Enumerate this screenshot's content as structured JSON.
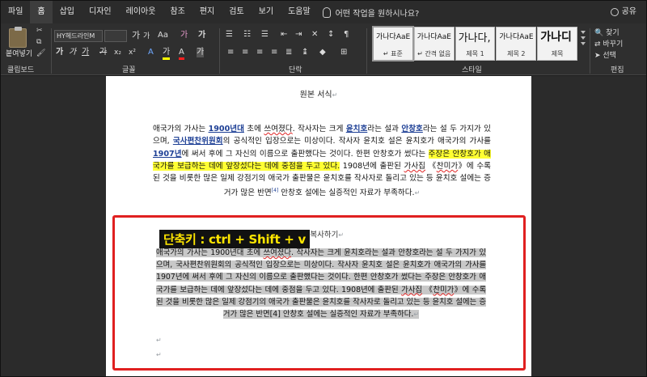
{
  "menu": {
    "tabs": [
      "파일",
      "홈",
      "삽입",
      "디자인",
      "레이아웃",
      "참조",
      "편지",
      "검토",
      "보기",
      "도움말"
    ],
    "active_tab": "홈",
    "tell_me": "어떤 작업을 원하시나요?",
    "share": "공유"
  },
  "ribbon": {
    "clipboard": {
      "paste_label": "붙여넣기",
      "group_label": "클립보드"
    },
    "font": {
      "font_name": "HY헤드라인M",
      "size": "",
      "group_label": "글꼴",
      "glyphs": {
        "grow": "가",
        "shrink": "가",
        "case": "Aa",
        "clear": "가",
        "bold": "가",
        "italic": "가",
        "underline": "가",
        "strike": "가",
        "sub": "x₂",
        "sup": "x²",
        "effects": "A",
        "highlight": "가",
        "color": "A",
        "shade": "가"
      }
    },
    "paragraph": {
      "group_label": "단락"
    },
    "styles": {
      "group_label": "스타일",
      "tiles": [
        {
          "sample": "가나다AaE",
          "name": "↵ 표준",
          "size": "normal"
        },
        {
          "sample": "가나다AaE",
          "name": "↵ 간격 없음",
          "size": "normal"
        },
        {
          "sample": "가나다,",
          "name": "제목 1",
          "size": "big"
        },
        {
          "sample": "가나다AaE",
          "name": "제목 2",
          "size": "normal"
        },
        {
          "sample": "가나디",
          "name": "제목",
          "size": "bigger"
        }
      ]
    },
    "editing": {
      "group_label": "편집",
      "find": "찾기",
      "replace": "바꾸기",
      "select": "선택"
    }
  },
  "document": {
    "original_heading": "원본 서식",
    "original_runs": [
      {
        "t": "애국가의 가사는 "
      },
      {
        "t": "1900년대",
        "s": "lnk"
      },
      {
        "t": " 초에 "
      },
      {
        "t": "쓰여졌다",
        "s": "sq"
      },
      {
        "t": ". 작사자는 크게 "
      },
      {
        "t": "윤치호",
        "s": "lnk"
      },
      {
        "t": "라는 설과 "
      },
      {
        "t": "안창호",
        "s": "lnk"
      },
      {
        "t": "라는 설 두 가지가 있으며, "
      },
      {
        "t": "국사편찬위원회",
        "s": "lnk"
      },
      {
        "t": "의 공식적인 입장으로는 미상이다. 작사자 윤치호 설은 윤치호가 애국가의 가사를 "
      },
      {
        "t": "1907년",
        "s": "lnk"
      },
      {
        "t": "에 써서 후에 그 자신의 이름으로 출판했다는 것이다. 한편 안창호가 썼다는 "
      },
      {
        "t": "주장은 안창호가 애국가를 보급하는 데에 앞장섰다는 데에 중점을 두고 있다.",
        "s": "hl"
      },
      {
        "t": " 1908년에 출판된 "
      },
      {
        "t": "가사집",
        "s": "sq"
      },
      {
        "t": " 《"
      },
      {
        "t": "찬미가",
        "s": "sq"
      },
      {
        "t": "》에 수록된 것을 비롯한 많은 일제 강점기의 애국가 출판물은 윤치호를 작사자로 돌리고 있는 등 윤치호 설에는 증거가 많은 반면"
      },
      {
        "t": "[4]",
        "s": "sup"
      },
      {
        "t": " 안창호 설에는 실증적인 자료가 부족하다."
      },
      {
        "t": "↵",
        "s": "mark"
      }
    ],
    "copy_heading": "서식 복사하기",
    "copy_runs": [
      {
        "t": "애국가의 가사는 1900년대 초에 "
      },
      {
        "t": "쓰여졌다",
        "s": "sq"
      },
      {
        "t": ". 작사자는 크게 윤치호라는 설과 안창호라는 설 두 가지가 있으며, 국사편찬위원회의 공식적인 입장으로는 미상이다. 작사자 윤치호 설은 윤치호가 애국가의 가사를 1907년에 써서 후에 그 자신의 이름으로 출판했다는 것이다. 한편 안창호가 썼다는 주장은 안창호가 애국가를 보급하는 데에 앞장섰다는 데에 중점을 두고 있다. 1908년에 출판된 "
      },
      {
        "t": "가사집",
        "s": "sq"
      },
      {
        "t": " 《"
      },
      {
        "t": "찬미가",
        "s": "sq"
      },
      {
        "t": "》에 수록된 것을 비롯한 많은 일제 강점기의 애국가 출판물은 윤치호를 작사자로 돌리고 있는 등 윤치호 설에는 증거가 많은 반면[4] 안창호 설에는 실증적인 자료가 부족하다."
      },
      {
        "t": "↵",
        "s": "mark"
      }
    ],
    "paragraph_mark": "↵"
  },
  "annotation": {
    "shortcut": "단축키 : ctrl + Shift + v",
    "box_color": "#e02020",
    "text_color": "#ffe600"
  }
}
